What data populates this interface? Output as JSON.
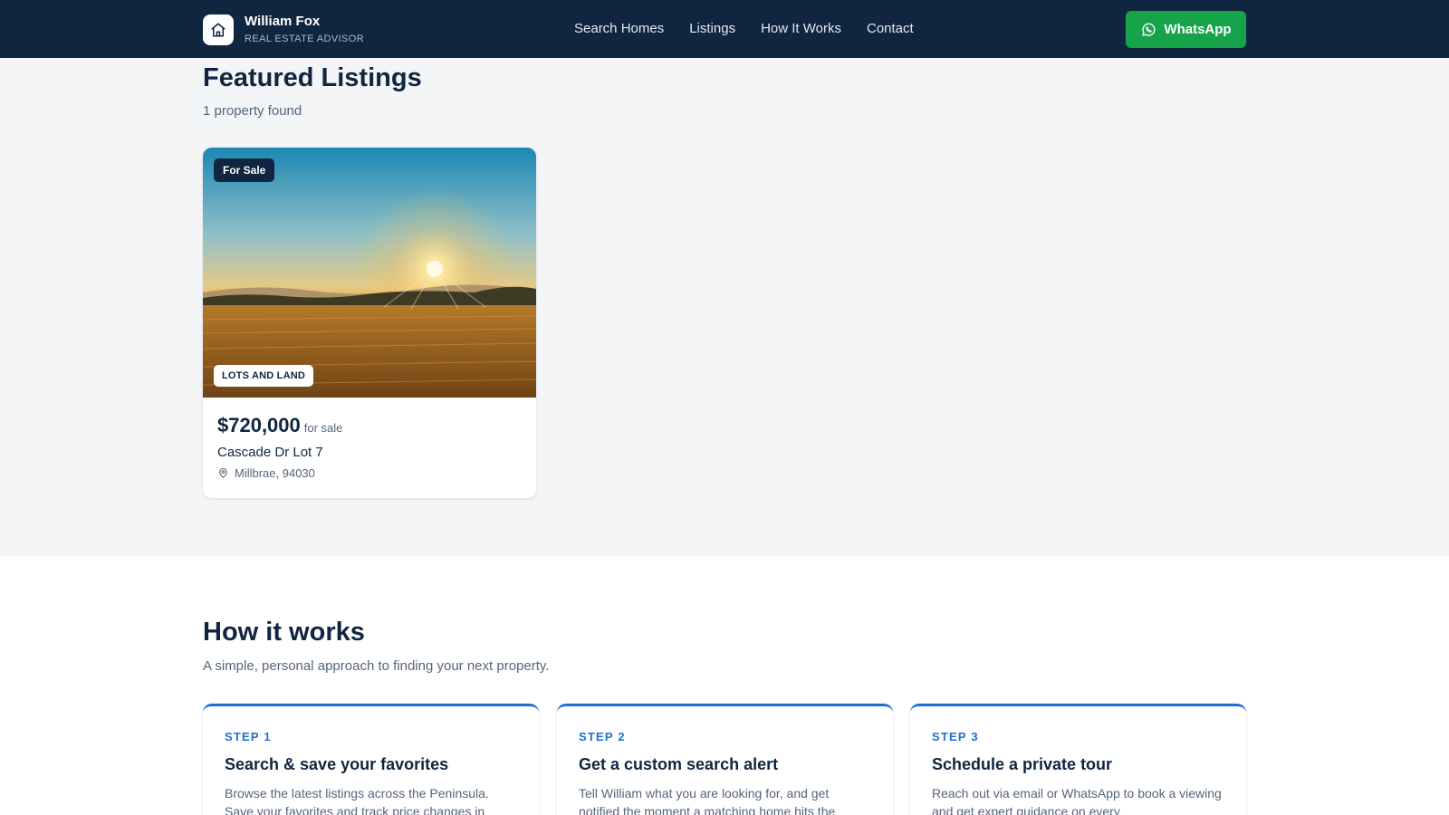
{
  "header": {
    "brand_name": "William Fox",
    "brand_subtitle": "REAL ESTATE ADVISOR",
    "nav": [
      "Search Homes",
      "Listings",
      "How It Works",
      "Contact"
    ],
    "whatsapp_label": "WhatsApp"
  },
  "featured": {
    "title": "Featured Listings",
    "count_text": "1 property found",
    "listings": [
      {
        "status_badge": "For Sale",
        "type_badge": "LOTS AND LAND",
        "price": "$720,000",
        "price_suffix": "for sale",
        "address": "Cascade Dr Lot 7",
        "location": "Millbrae, 94030"
      }
    ]
  },
  "how_it_works": {
    "title": "How it works",
    "subtitle": "A simple, personal approach to finding your next property.",
    "steps": [
      {
        "label": "STEP 1",
        "title": "Search & save your favorites",
        "description": "Browse the latest listings across the Peninsula. Save your favorites and track price changes in"
      },
      {
        "label": "STEP 2",
        "title": "Get a custom search alert",
        "description": "Tell William what you are looking for, and get notified the moment a matching home hits the"
      },
      {
        "label": "STEP 3",
        "title": "Schedule a private tour",
        "description": "Reach out via email or WhatsApp to book a viewing and get expert guidance on every"
      }
    ]
  },
  "icons": {
    "logo": "house-icon",
    "whatsapp": "whatsapp-icon",
    "location": "map-pin-icon"
  },
  "colors": {
    "navy": "#0f2540",
    "accent_blue": "#1d6fd1",
    "whatsapp_green": "#16a34a"
  }
}
